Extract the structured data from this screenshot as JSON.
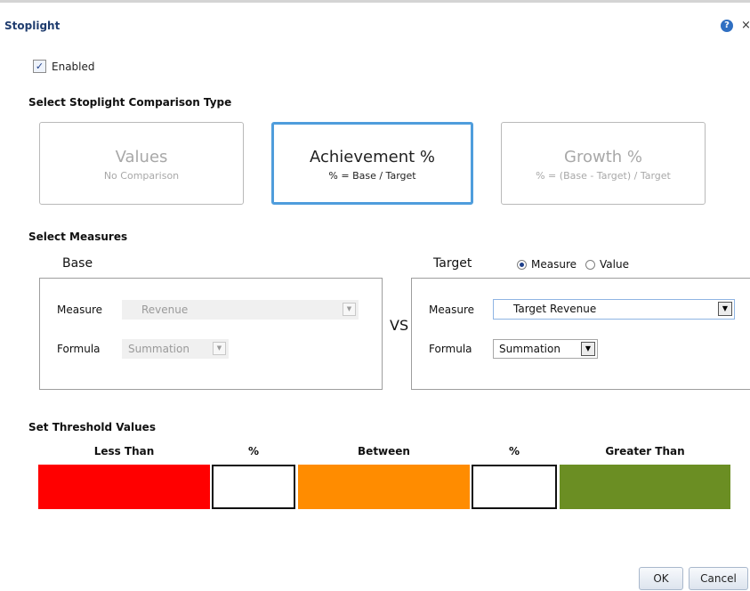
{
  "dialog": {
    "title": "Stoplight",
    "help_icon": "?",
    "close_icon": "×"
  },
  "enabled": {
    "label": "Enabled",
    "checked": true,
    "check_glyph": "✓"
  },
  "comparison": {
    "section_title": "Select Stoplight Comparison Type",
    "options": [
      {
        "label": "Values",
        "sub": "No Comparison",
        "selected": false
      },
      {
        "label": "Achievement %",
        "sub": "% = Base / Target",
        "selected": true
      },
      {
        "label": "Growth %",
        "sub": "% = (Base - Target) / Target",
        "selected": false
      }
    ]
  },
  "measures": {
    "section_title": "Select Measures",
    "vs": "VS",
    "base": {
      "label": "Base",
      "measure_label": "Measure",
      "measure_value": "Revenue",
      "formula_label": "Formula",
      "formula_value": "Summation"
    },
    "target": {
      "label": "Target",
      "radio_measure": "Measure",
      "radio_value": "Value",
      "selected_radio": "Measure",
      "measure_label": "Measure",
      "measure_value": "Target Revenue",
      "formula_label": "Formula",
      "formula_value": "Summation"
    }
  },
  "threshold": {
    "section_title": "Set Threshold Values",
    "headers": [
      "Less Than",
      "%",
      "Between",
      "%",
      "Greater Than"
    ],
    "colors": {
      "less_than": "#ff0000",
      "between": "#ff8c00",
      "greater_than": "#6b8e23"
    },
    "low_value": "",
    "high_value": ""
  },
  "buttons": {
    "ok": "OK",
    "cancel": "Cancel"
  },
  "dropdown_arrow": "▼"
}
